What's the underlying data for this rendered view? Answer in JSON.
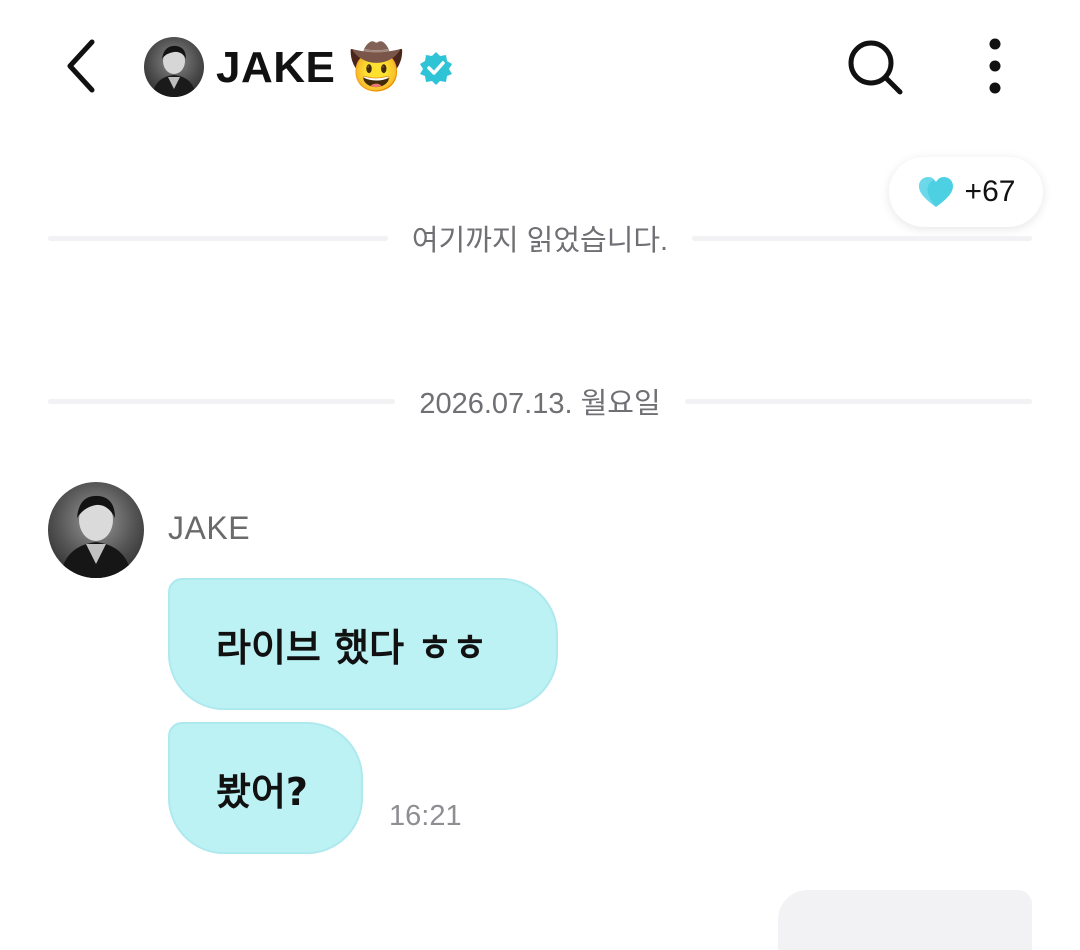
{
  "header": {
    "title": "JAKE",
    "title_emoji": "🤠",
    "verified": true,
    "icons": [
      "back-arrow-icon",
      "search-icon",
      "more-vertical-icon",
      "verified-badge-icon"
    ]
  },
  "reaction": {
    "icon": "heart-icon",
    "count": "+67",
    "color": "#4ed0e3"
  },
  "dividers": {
    "read_marker": "여기까지 읽었습니다.",
    "date": "2026.07.13. 월요일"
  },
  "message_group": {
    "sender": "JAKE",
    "messages": [
      {
        "text": "라이브 했다 ㅎㅎ"
      },
      {
        "text": "봤어?"
      }
    ],
    "time": "16:21"
  },
  "colors": {
    "bubble": "#bdf2f5",
    "accent": "#2ec4d6",
    "divider": "#f2f2f5"
  }
}
